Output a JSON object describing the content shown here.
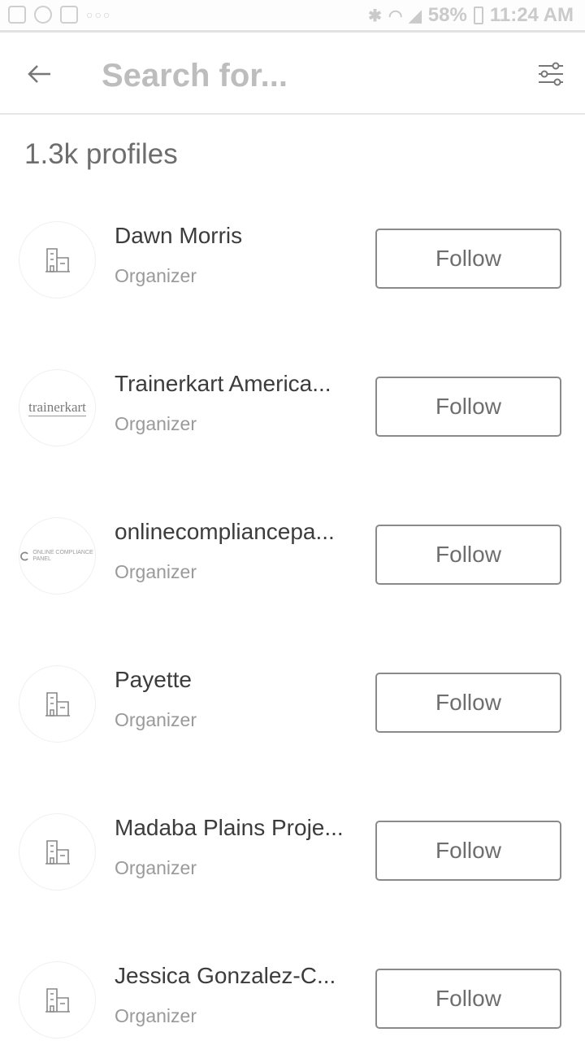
{
  "status_bar": {
    "battery": "58%",
    "time": "11:24 AM"
  },
  "search": {
    "placeholder": "Search for..."
  },
  "results": {
    "count_label": "1.3k profiles"
  },
  "logos": {
    "trainerkart": "trainerkart",
    "ocp": "ONLINE COMPLIANCE PANEL"
  },
  "profiles": [
    {
      "name": "Dawn Morris",
      "role": "Organizer",
      "follow_label": "Follow",
      "avatar": "building-icon"
    },
    {
      "name": "Trainerkart America...",
      "role": "Organizer",
      "follow_label": "Follow",
      "avatar": "trainerkart-logo"
    },
    {
      "name": "onlinecompliancepa...",
      "role": "Organizer",
      "follow_label": "Follow",
      "avatar": "online-compliance-panel-logo"
    },
    {
      "name": "Payette",
      "role": "Organizer",
      "follow_label": "Follow",
      "avatar": "building-icon"
    },
    {
      "name": "Madaba Plains Proje...",
      "role": "Organizer",
      "follow_label": "Follow",
      "avatar": "building-icon"
    },
    {
      "name": "Jessica Gonzalez-C...",
      "role": "Organizer",
      "follow_label": "Follow",
      "avatar": "building-icon"
    }
  ]
}
